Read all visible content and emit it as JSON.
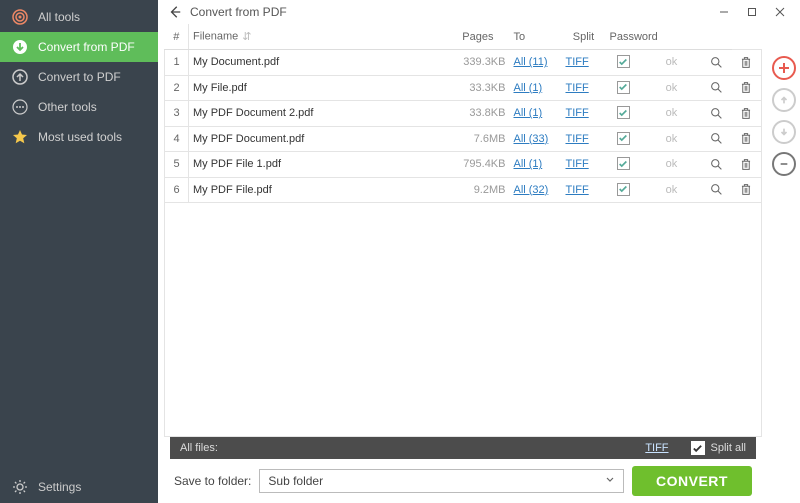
{
  "sidebar": {
    "items": [
      {
        "label": "All tools"
      },
      {
        "label": "Convert from PDF"
      },
      {
        "label": "Convert to PDF"
      },
      {
        "label": "Other tools"
      },
      {
        "label": "Most used tools"
      }
    ],
    "settings_label": "Settings"
  },
  "header": {
    "title": "Convert from PDF"
  },
  "table": {
    "headers": {
      "idx": "#",
      "filename": "Filename",
      "pages": "Pages",
      "to": "To",
      "split": "Split",
      "password": "Password"
    },
    "rows": [
      {
        "idx": "1",
        "filename": "My Document.pdf",
        "size": "339.3KB",
        "pages": "All (11)",
        "to": "TIFF",
        "split": true,
        "password": "ok"
      },
      {
        "idx": "2",
        "filename": "My File.pdf",
        "size": "33.3KB",
        "pages": "All (1)",
        "to": "TIFF",
        "split": true,
        "password": "ok"
      },
      {
        "idx": "3",
        "filename": "My PDF Document 2.pdf",
        "size": "33.8KB",
        "pages": "All (1)",
        "to": "TIFF",
        "split": true,
        "password": "ok"
      },
      {
        "idx": "4",
        "filename": "My PDF Document.pdf",
        "size": "7.6MB",
        "pages": "All (33)",
        "to": "TIFF",
        "split": true,
        "password": "ok"
      },
      {
        "idx": "5",
        "filename": "My PDF File 1.pdf",
        "size": "795.4KB",
        "pages": "All (1)",
        "to": "TIFF",
        "split": true,
        "password": "ok"
      },
      {
        "idx": "6",
        "filename": "My PDF File.pdf",
        "size": "9.2MB",
        "pages": "All (32)",
        "to": "TIFF",
        "split": true,
        "password": "ok"
      }
    ]
  },
  "allfiles": {
    "label": "All files:",
    "to": "TIFF",
    "split_all": "Split all"
  },
  "bottom": {
    "save_label": "Save to folder:",
    "folder": "Sub folder",
    "convert": "CONVERT"
  }
}
